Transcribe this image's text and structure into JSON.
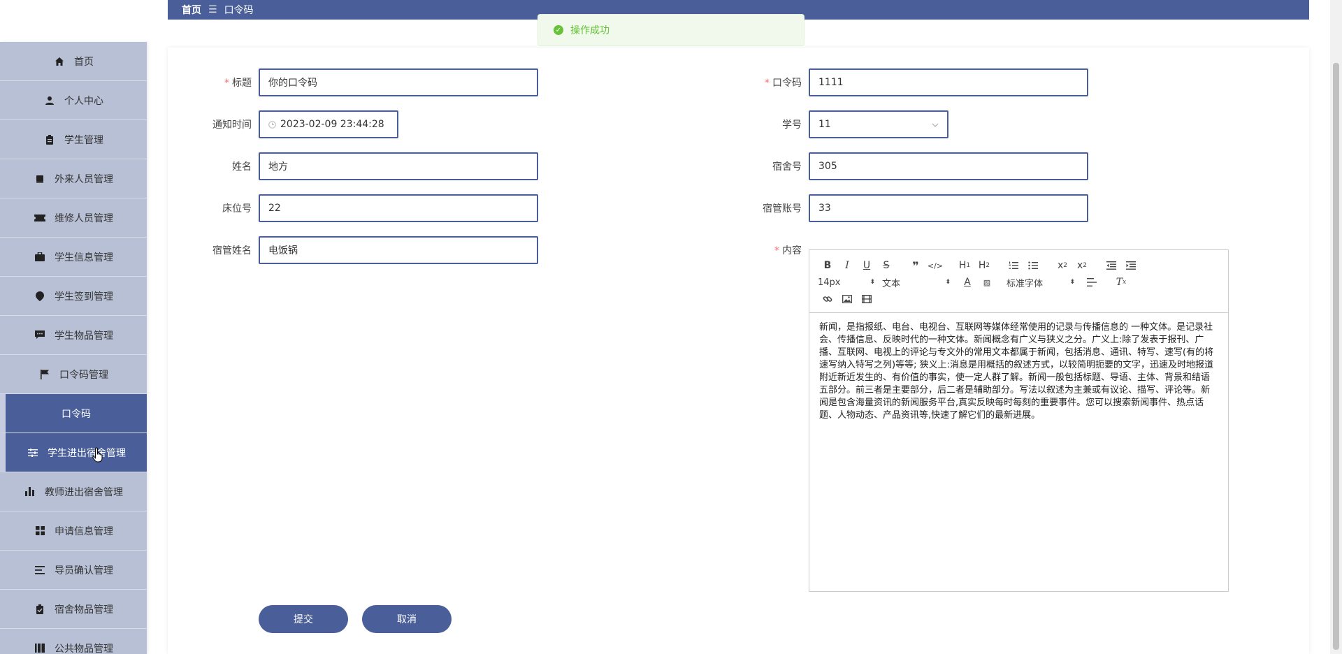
{
  "breadcrumb": {
    "home": "首页",
    "separator": "☰",
    "current": "口令码"
  },
  "toast": {
    "message": "操作成功",
    "icon": "check-circle-icon"
  },
  "sidebar": {
    "items": [
      {
        "label": "首页",
        "icon": "home-icon"
      },
      {
        "label": "个人中心",
        "icon": "user-icon"
      },
      {
        "label": "学生管理",
        "icon": "clipboard-icon"
      },
      {
        "label": "外来人员管理",
        "icon": "book-icon"
      },
      {
        "label": "维修人员管理",
        "icon": "ticket-icon"
      },
      {
        "label": "学生信息管理",
        "icon": "briefcase-icon"
      },
      {
        "label": "学生签到管理",
        "icon": "pin-icon"
      },
      {
        "label": "学生物品管理",
        "icon": "message-icon"
      },
      {
        "label": "口令码管理",
        "icon": "flag-icon"
      },
      {
        "label": "口令码",
        "icon": ""
      },
      {
        "label": "学生进出宿舍管理",
        "icon": "sliders-icon"
      },
      {
        "label": "教师进出宿舍管理",
        "icon": "bar-chart-icon"
      },
      {
        "label": "申请信息管理",
        "icon": "grid-icon"
      },
      {
        "label": "导员确认管理",
        "icon": "list-icon"
      },
      {
        "label": "宿舍物品管理",
        "icon": "clipboard-check-icon"
      },
      {
        "label": "公共物品管理",
        "icon": "columns-icon"
      }
    ]
  },
  "form": {
    "title": {
      "label": "标题",
      "value": "你的口令码"
    },
    "code": {
      "label": "口令码",
      "value": "1111"
    },
    "notify_time": {
      "label": "通知时间",
      "value": "2023-02-09 23:44:28"
    },
    "student_no": {
      "label": "学号",
      "value": "11"
    },
    "name": {
      "label": "姓名",
      "value": "地方"
    },
    "dorm_no": {
      "label": "宿舍号",
      "value": "305"
    },
    "bed_no": {
      "label": "床位号",
      "value": "22"
    },
    "manager_account": {
      "label": "宿管账号",
      "value": "33"
    },
    "manager_name": {
      "label": "宿管姓名",
      "value": "电饭锅"
    },
    "content": {
      "label": "内容"
    },
    "required_mark": "*"
  },
  "editor": {
    "font_size": "14px",
    "header_select": "文本",
    "font_family": "标准字体",
    "body_text": "新闻，是指报纸、电台、电视台、互联网等媒体经常使用的记录与传播信息的 一种文体。是记录社会、传播信息、反映时代的一种文体。新闻概念有广义与狭义之分。广义上:除了发表于报刊、广播、互联网、电视上的评论与专文外的常用文本都属于新闻，包括消息、通讯、特写、速写(有的将速写纳入特写之列)等等; 狭义上:消息是用概括的叙述方式，以较简明扼要的文字，迅速及时地报道附近新近发生的、有价值的事实，使一定人群了解。新闻一般包括标题、导语、主体、背景和结语五部分。前三者是主要部分，后二者是辅助部分。写法以叙述为主兼或有议论、描写、评论等。新闻是包含海量资讯的新闻服务平台,真实反映每时每刻的重要事件。您可以搜索新闻事件、热点话题、人物动态、产品资讯等,快速了解它们的最新进展。"
  },
  "buttons": {
    "submit": "提交",
    "cancel": "取消"
  }
}
